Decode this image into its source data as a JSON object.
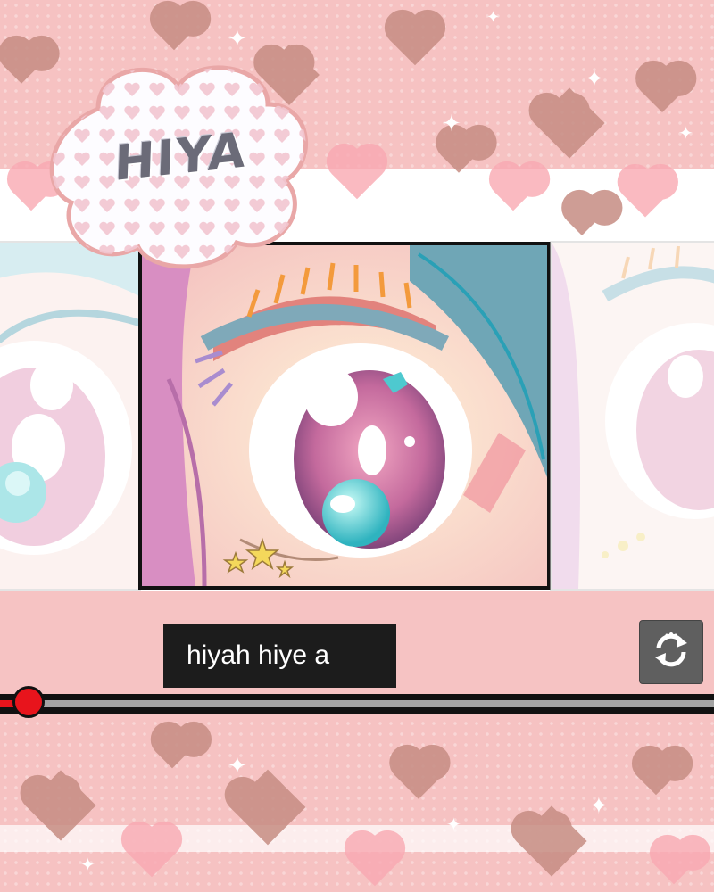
{
  "comic": {
    "sfx_text": "HIYA",
    "caption": "hiyah hiye a"
  },
  "player": {
    "progress_percent": 4,
    "refresh_icon": "refresh-icon"
  },
  "colors": {
    "background_pink": "#f6c2c2",
    "heart_brown": "#c68d83",
    "heart_pink": "#f9a9b2",
    "progress_red": "#e8141c",
    "caption_bg": "#1c1c1c",
    "button_gray": "#5f5f5f"
  }
}
